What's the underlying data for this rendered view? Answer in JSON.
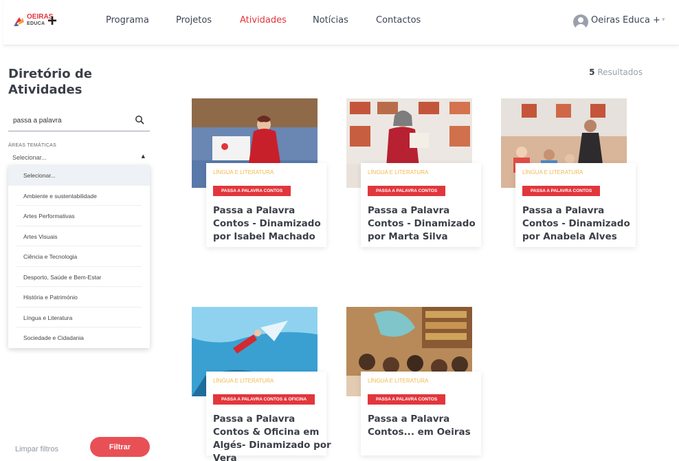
{
  "brand": {
    "name_top": "OEIRAS",
    "name_bottom": "EDUCA",
    "plus": "+"
  },
  "nav": {
    "items": [
      {
        "label": "Programa",
        "active": false
      },
      {
        "label": "Projetos",
        "active": false
      },
      {
        "label": "Atividades",
        "active": true
      },
      {
        "label": "Notícias",
        "active": false
      },
      {
        "label": "Contactos",
        "active": false
      }
    ]
  },
  "user": {
    "name": "Oeiras Educa +",
    "icon": "avatar-icon"
  },
  "sidebar": {
    "title": "Diretório de Atividades",
    "search": {
      "value": "passa a palavra",
      "icon": "search-icon"
    },
    "areas_label": "ÁREAS TEMÁTICAS",
    "select_value": "Selecionar...",
    "options": [
      "Selecionar...",
      "Ambiente e sustentabilidade",
      "Artes Performativas",
      "Artes Visuais",
      "Ciência e Tecnologia",
      "Desporto, Saúde e Bem-Estar",
      "História e Património",
      "Língua e Literatura",
      "Sociedade e Cidadania"
    ],
    "clear_label": "Limpar filtros",
    "filter_label": "Filtrar"
  },
  "results": {
    "count": "5",
    "label": "Resultados"
  },
  "cards": [
    {
      "category": "LÍNGUA E LITERATURA",
      "tag": "PASSA A PALAVRA CONTOS",
      "title": "Passa a Palavra Contos - Dinamizado por Isabel Machado"
    },
    {
      "category": "LÍNGUA E LITERATURA",
      "tag": "PASSA A PALAVRA CONTOS",
      "title": "Passa a Palavra Contos - Dinamizado por Marta Silva"
    },
    {
      "category": "LÍNGUA E LITERATURA",
      "tag": "PASSA A PALAVRA CONTOS",
      "title": "Passa a Palavra Contos - Dinamizado por Anabela Alves"
    },
    {
      "category": "LÍNGUA E LITERATURA",
      "tag": "PASSA A PALAVRA CONTOS & OFICINA",
      "title": "Passa a Palavra Contos & Oficina em Algés- Dinamizado por Vera"
    },
    {
      "category": "LÍNGUA E LITERATURA",
      "tag": "PASSA A PALAVRA CONTOS",
      "title": "Passa a Palavra Contos... em Oeiras"
    }
  ],
  "colors": {
    "accent": "#e2343b",
    "category": "#f2b84a",
    "button": "#e85056"
  }
}
